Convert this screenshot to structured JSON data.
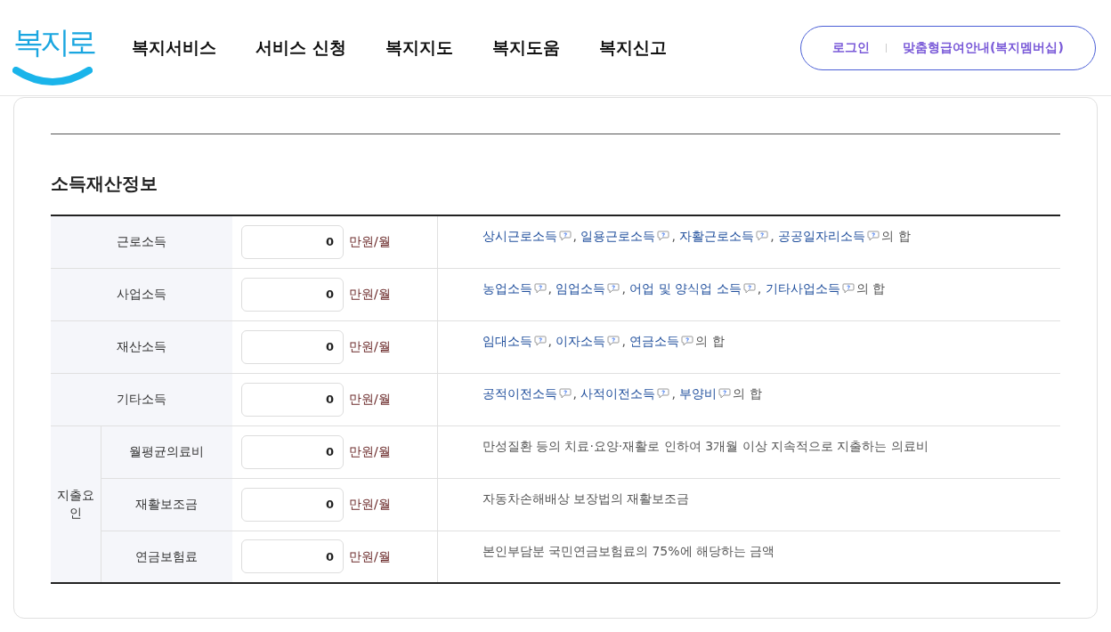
{
  "header": {
    "logo": "복지로",
    "nav": [
      "복지서비스",
      "서비스 신청",
      "복지지도",
      "복지도움",
      "복지신고"
    ],
    "login": "로그인",
    "membership": "맞춤형급여안내(복지멤버십)"
  },
  "section": {
    "title": "소득재산정보",
    "rows": [
      {
        "kind": "single",
        "label": "근로소득",
        "value": "0",
        "unit": "만원/월",
        "terms": [
          {
            "label": "상시근로소득",
            "sep": ","
          },
          {
            "label": "일용근로소득",
            "sep": ","
          },
          {
            "label": "자활근로소득",
            "sep": ","
          },
          {
            "label": "공공일자리소득"
          }
        ],
        "suffix": "의 합"
      },
      {
        "kind": "single",
        "label": "사업소득",
        "value": "0",
        "unit": "만원/월",
        "terms": [
          {
            "label": "농업소득",
            "sep": ","
          },
          {
            "label": "임업소득",
            "sep": ","
          },
          {
            "label": "어업 및 양식업 소득",
            "sep": ","
          },
          {
            "label": "기타사업소득"
          }
        ],
        "suffix": "의 합"
      },
      {
        "kind": "single",
        "label": "재산소득",
        "value": "0",
        "unit": "만원/월",
        "terms": [
          {
            "label": "임대소득",
            "sep": ","
          },
          {
            "label": "이자소득",
            "sep": ","
          },
          {
            "label": "연금소득"
          }
        ],
        "suffix": "의 합"
      },
      {
        "kind": "single",
        "label": "기타소득",
        "value": "0",
        "unit": "만원/월",
        "terms": [
          {
            "label": "공적이전소득",
            "sep": ","
          },
          {
            "label": "사적이전소득",
            "sep": ","
          },
          {
            "label": "부양비"
          }
        ],
        "suffix": "의 합"
      },
      {
        "kind": "group",
        "group": "지출요인",
        "label": "월평균의료비",
        "value": "0",
        "unit": "만원/월",
        "text": "만성질환 등의 치료·요양·재활로 인하여 3개월 이상 지속적으로 지출하는 의료비"
      },
      {
        "kind": "group",
        "label": "재활보조금",
        "value": "0",
        "unit": "만원/월",
        "text": "자동차손해배상 보장법의 재활보조금"
      },
      {
        "kind": "group",
        "label": "연금보험료",
        "value": "0",
        "unit": "만원/월",
        "text": "본인부담분 국민연금보험료의 75%에 해당하는 금액"
      }
    ]
  }
}
